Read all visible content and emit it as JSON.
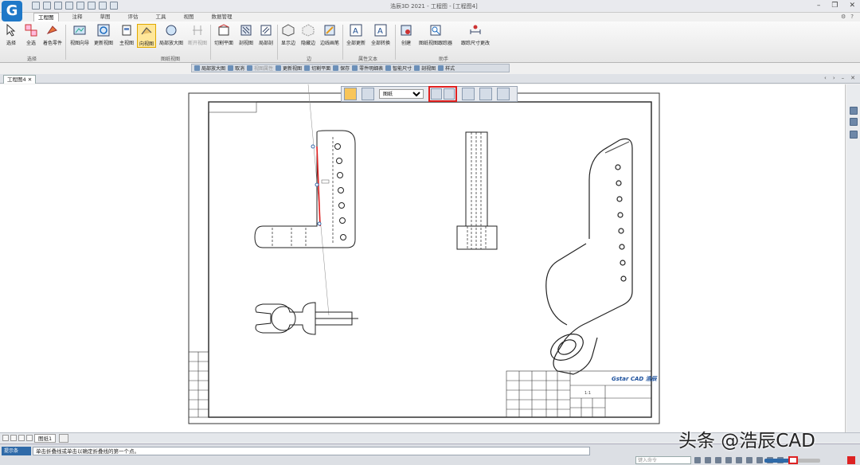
{
  "app": {
    "window_title": "浩辰3D 2021 - 工程图 - [工程图4]"
  },
  "ribbon": {
    "tabs": [
      "工程图",
      "注释",
      "草图",
      "评估",
      "工具",
      "视图",
      "数据管理"
    ],
    "active_tab": "工程图",
    "buttons": {
      "select": "选择",
      "select_all": "全选",
      "color_parts": "着色零件",
      "view_wizard": "视图向导",
      "update_views": "更新视图",
      "main_view": "主视图",
      "aux_view": "向视图",
      "detail_view": "局部放大图",
      "broken_view": "断开视图",
      "cut_plane": "切割平面",
      "section_view": "剖视图",
      "partial_section": "局部剖",
      "show_edge": "显示边",
      "hide_edge": "隐藏边",
      "edge_brush": "边线画笔",
      "update_all": "全部更新",
      "convert_all": "全部转换",
      "create": "创建",
      "view_tracker": "图纸视图跟踪器",
      "track_dim": "跟踪尺寸更改"
    },
    "groups": {
      "select": "选择",
      "drawing_views": "图纸视图",
      "edges": "边",
      "property_text": "属性文本",
      "assistant": "助手"
    }
  },
  "toolbar2": {
    "items": [
      {
        "label": "局部放大图",
        "dim": false
      },
      {
        "label": "取消",
        "dim": false
      },
      {
        "label": "视图属性",
        "dim": true
      },
      {
        "label": "更新视图",
        "dim": false
      },
      {
        "label": "切割平面",
        "dim": false
      },
      {
        "label": "保存",
        "dim": false
      },
      {
        "label": "零件明细表",
        "dim": false
      },
      {
        "label": "智能尺寸",
        "dim": false
      },
      {
        "label": "剖视图",
        "dim": false
      },
      {
        "label": "样式",
        "dim": false
      }
    ]
  },
  "doc_tab": "工程图4",
  "minibar": {
    "select_value": "图纸"
  },
  "drawing": {
    "scale_label": "1:1",
    "titleblock_logo": "Gstar CAD 浩辰",
    "accent_red": "#e02020"
  },
  "sheet_tab": "图纸1",
  "status": {
    "prompt_label": "提示条",
    "prompt_text": "单击折叠线或单击以确定折叠线的第一个点。",
    "command_placeholder": "键入命令"
  },
  "watermark": "头条 @浩辰CAD"
}
